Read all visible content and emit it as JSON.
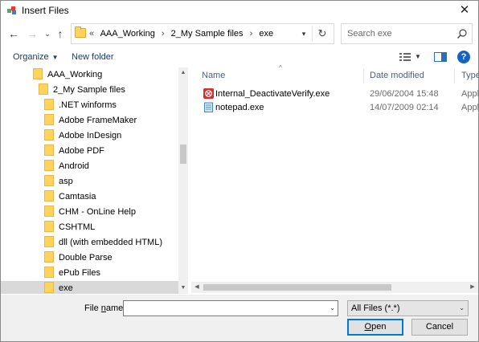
{
  "window": {
    "title": "Insert Files"
  },
  "nav": {
    "breadcrumb": [
      "AAA_Working",
      "2_My Sample files",
      "exe"
    ],
    "overflow": "«"
  },
  "search": {
    "placeholder": "Search exe"
  },
  "toolbar": {
    "organize": "Organize",
    "new_folder": "New folder"
  },
  "tree": {
    "items": [
      {
        "label": "AAA_Working",
        "indent": 0
      },
      {
        "label": "2_My Sample files",
        "indent": 1
      },
      {
        "label": ".NET winforms",
        "indent": 2
      },
      {
        "label": "Adobe FrameMaker",
        "indent": 2
      },
      {
        "label": "Adobe InDesign",
        "indent": 2
      },
      {
        "label": "Adobe PDF",
        "indent": 2
      },
      {
        "label": "Android",
        "indent": 2
      },
      {
        "label": "asp",
        "indent": 2
      },
      {
        "label": "Camtasia",
        "indent": 2
      },
      {
        "label": "CHM - OnLine Help",
        "indent": 2
      },
      {
        "label": "CSHTML",
        "indent": 2
      },
      {
        "label": "dll (with embedded HTML)",
        "indent": 2
      },
      {
        "label": "Double Parse",
        "indent": 2
      },
      {
        "label": "ePub Files",
        "indent": 2
      },
      {
        "label": "exe",
        "indent": 2,
        "selected": true
      }
    ]
  },
  "columns": {
    "name": "Name",
    "date": "Date modified",
    "type": "Type"
  },
  "files": [
    {
      "name": "Internal_DeactivateVerify.exe",
      "date": "29/06/2004 15:48",
      "type": "Appli",
      "icon": "error-app-icon"
    },
    {
      "name": "notepad.exe",
      "date": "14/07/2009 02:14",
      "type": "Appli",
      "icon": "notepad-icon"
    }
  ],
  "bottom": {
    "file_name_label_pre": "File ",
    "file_name_label_ul": "n",
    "file_name_label_post": "ame:",
    "file_name_value": "",
    "filter": "All Files (*.*)",
    "open_label_ul": "O",
    "open_label_post": "pen",
    "cancel": "Cancel"
  }
}
